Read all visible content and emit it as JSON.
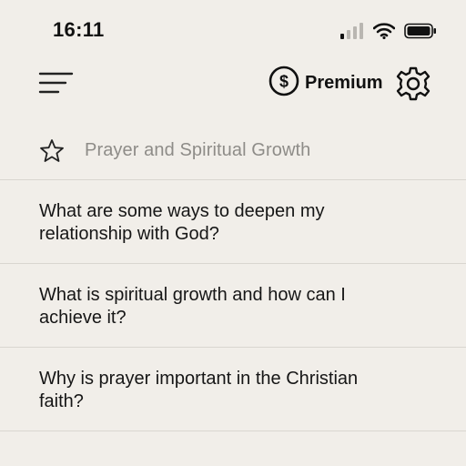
{
  "status_bar": {
    "time": "16:11",
    "icons": [
      "cellular-signal-icon",
      "wifi-icon",
      "battery-icon"
    ]
  },
  "header": {
    "menu_icon": "hamburger-menu-icon",
    "premium_icon": "dollar-circle-icon",
    "premium_label": "Premium",
    "settings_icon": "gear-icon"
  },
  "category": {
    "icon": "star-icon",
    "title": "Prayer and Spiritual Growth"
  },
  "questions": [
    {
      "text": "What are some ways to deepen my relationship with God?"
    },
    {
      "text": "What is spiritual growth and how can I achieve it?"
    },
    {
      "text": "Why is prayer important in the Christian faith?"
    }
  ],
  "colors": {
    "background": "#F1EEE9",
    "text": "#161616",
    "muted_text": "#8E8C88",
    "divider": "#D9D6D0"
  }
}
